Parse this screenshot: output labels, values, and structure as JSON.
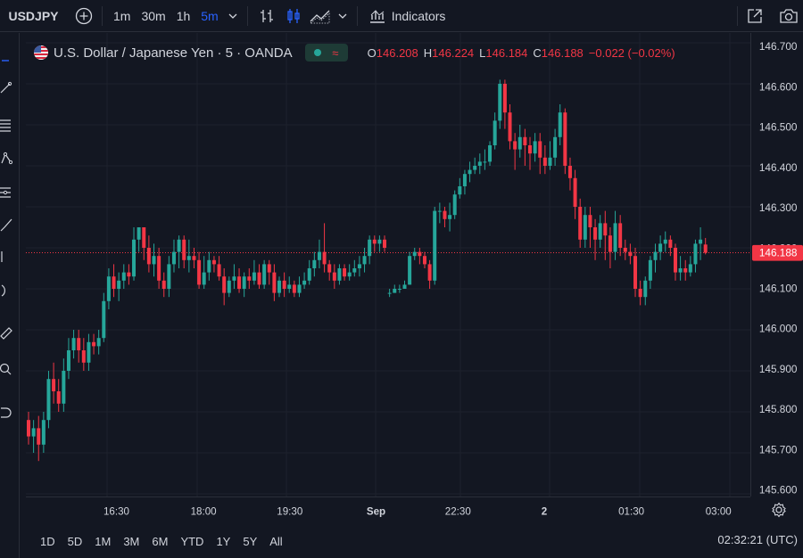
{
  "toolbar": {
    "symbol": "USDJPY",
    "timeframes": [
      "1m",
      "30m",
      "1h",
      "5m"
    ],
    "active_timeframe": "5m",
    "indicators_label": "Indicators"
  },
  "legend": {
    "title": "U.S. Dollar / Japanese Yen · 5 · OANDA",
    "open_label": "O",
    "open": "146.208",
    "high_label": "H",
    "high": "146.224",
    "low_label": "L",
    "low": "146.184",
    "close_label": "C",
    "close": "146.188",
    "change": "−0.022 (−0.02%)"
  },
  "price_axis": {
    "ticks": [
      "146.700",
      "146.600",
      "146.500",
      "146.400",
      "146.300",
      "146.200",
      "146.100",
      "146.000",
      "145.900",
      "145.800",
      "145.700",
      "145.600"
    ],
    "current": "146.188"
  },
  "time_axis": {
    "ticks": [
      "16:30",
      "18:00",
      "19:30",
      "Sep",
      "22:30",
      "2",
      "01:30",
      "03:00"
    ]
  },
  "bottom": {
    "ranges": [
      "1D",
      "5D",
      "1M",
      "3M",
      "6M",
      "YTD",
      "1Y",
      "5Y",
      "All"
    ],
    "clock": "02:32:21 (UTC)"
  },
  "colors": {
    "up": "#26a69a",
    "down": "#f23645",
    "accent": "#2962ff",
    "background": "#131722"
  },
  "chart_data": {
    "type": "candlestick",
    "title": "U.S. Dollar / Japanese Yen · 5 · OANDA",
    "ylim": [
      145.6,
      146.7
    ],
    "current_price": 146.188,
    "x_ticks": [
      "16:30",
      "18:00",
      "19:30",
      "Sep",
      "22:30",
      "2",
      "01:30",
      "03:00"
    ],
    "candles": [
      [
        145.78,
        145.74,
        145.8,
        145.72
      ],
      [
        145.74,
        145.76,
        145.78,
        145.7
      ],
      [
        145.76,
        145.72,
        145.79,
        145.68
      ],
      [
        145.72,
        145.78,
        145.8,
        145.7
      ],
      [
        145.78,
        145.88,
        145.9,
        145.76
      ],
      [
        145.88,
        145.85,
        145.92,
        145.82
      ],
      [
        145.85,
        145.82,
        145.88,
        145.8
      ],
      [
        145.82,
        145.9,
        145.93,
        145.8
      ],
      [
        145.9,
        145.95,
        145.98,
        145.88
      ],
      [
        145.95,
        145.98,
        146.0,
        145.93
      ],
      [
        145.98,
        145.95,
        146.0,
        145.92
      ],
      [
        145.95,
        145.92,
        145.98,
        145.9
      ],
      [
        145.92,
        145.97,
        145.99,
        145.9
      ],
      [
        145.97,
        145.96,
        145.99,
        145.94
      ],
      [
        145.96,
        145.98,
        146.0,
        145.94
      ],
      [
        145.98,
        146.07,
        146.09,
        145.97
      ],
      [
        146.07,
        146.13,
        146.15,
        146.05
      ],
      [
        146.13,
        146.1,
        146.16,
        146.08
      ],
      [
        146.1,
        146.12,
        146.14,
        146.07
      ],
      [
        146.12,
        146.14,
        146.16,
        146.1
      ],
      [
        146.14,
        146.13,
        146.16,
        146.11
      ],
      [
        146.13,
        146.22,
        146.25,
        146.12
      ],
      [
        146.22,
        146.25,
        146.25,
        146.19
      ],
      [
        146.25,
        146.2,
        146.25,
        146.17
      ],
      [
        146.2,
        146.16,
        146.23,
        146.14
      ],
      [
        146.16,
        146.18,
        146.21,
        146.13
      ],
      [
        146.18,
        146.12,
        146.2,
        146.1
      ],
      [
        146.12,
        146.1,
        146.14,
        146.08
      ],
      [
        146.1,
        146.16,
        146.18,
        146.08
      ],
      [
        146.16,
        146.19,
        146.22,
        146.14
      ],
      [
        146.19,
        146.22,
        146.23,
        146.15
      ],
      [
        146.22,
        146.17,
        146.23,
        146.15
      ],
      [
        146.17,
        146.18,
        146.22,
        146.14
      ],
      [
        146.18,
        146.17,
        146.2,
        146.15
      ],
      [
        146.17,
        146.11,
        146.19,
        146.1
      ],
      [
        146.11,
        146.14,
        146.18,
        146.1
      ],
      [
        146.14,
        146.17,
        146.19,
        146.12
      ],
      [
        146.17,
        146.16,
        146.18,
        146.14
      ],
      [
        146.16,
        146.13,
        146.18,
        146.12
      ],
      [
        146.13,
        146.09,
        146.15,
        146.06
      ],
      [
        146.09,
        146.12,
        146.13,
        146.08
      ],
      [
        146.12,
        146.13,
        146.16,
        146.1
      ],
      [
        146.13,
        146.1,
        146.15,
        146.09
      ],
      [
        146.1,
        146.13,
        146.14,
        146.08
      ],
      [
        146.13,
        146.12,
        146.15,
        146.1
      ],
      [
        146.12,
        146.14,
        146.17,
        146.11
      ],
      [
        146.14,
        146.11,
        146.16,
        146.1
      ],
      [
        146.11,
        146.16,
        146.17,
        146.1
      ],
      [
        146.16,
        146.14,
        146.17,
        146.11
      ],
      [
        146.14,
        146.09,
        146.16,
        146.07
      ],
      [
        146.09,
        146.12,
        146.13,
        146.08
      ],
      [
        146.12,
        146.1,
        146.14,
        146.08
      ],
      [
        146.1,
        146.11,
        146.13,
        146.09
      ],
      [
        146.11,
        146.09,
        146.12,
        146.08
      ],
      [
        146.09,
        146.11,
        146.13,
        146.08
      ],
      [
        146.11,
        146.12,
        146.14,
        146.1
      ],
      [
        146.12,
        146.15,
        146.17,
        146.11
      ],
      [
        146.15,
        146.17,
        146.19,
        146.13
      ],
      [
        146.17,
        146.19,
        146.22,
        146.15
      ],
      [
        146.19,
        146.16,
        146.26,
        146.14
      ],
      [
        146.16,
        146.14,
        146.17,
        146.12
      ],
      [
        146.14,
        146.12,
        146.16,
        146.1
      ],
      [
        146.12,
        146.15,
        146.16,
        146.11
      ],
      [
        146.15,
        146.13,
        146.16,
        146.12
      ],
      [
        146.13,
        146.14,
        146.16,
        146.12
      ],
      [
        146.14,
        146.15,
        146.17,
        146.13
      ],
      [
        146.15,
        146.16,
        146.18,
        146.13
      ],
      [
        146.16,
        146.18,
        146.2,
        146.14
      ],
      [
        146.18,
        146.22,
        146.23,
        146.16
      ],
      [
        146.22,
        146.21,
        146.23,
        146.19
      ],
      [
        146.21,
        146.22,
        146.23,
        146.19
      ],
      [
        146.22,
        146.2,
        146.23,
        146.19
      ],
      [
        146.09,
        146.09,
        146.1,
        146.08
      ],
      [
        146.09,
        146.1,
        146.11,
        146.09
      ],
      [
        146.1,
        146.1,
        146.11,
        146.09
      ],
      [
        146.1,
        146.11,
        146.12,
        146.1
      ],
      [
        146.11,
        146.18,
        146.19,
        146.11
      ],
      [
        146.18,
        146.19,
        146.2,
        146.17
      ],
      [
        146.19,
        146.18,
        146.2,
        146.16
      ],
      [
        146.18,
        146.16,
        146.19,
        146.15
      ],
      [
        146.16,
        146.12,
        146.17,
        146.1
      ],
      [
        146.12,
        146.29,
        146.3,
        146.11
      ],
      [
        146.29,
        146.29,
        146.31,
        146.26
      ],
      [
        146.29,
        146.27,
        146.3,
        146.25
      ],
      [
        146.27,
        146.28,
        146.31,
        146.24
      ],
      [
        146.28,
        146.33,
        146.34,
        146.27
      ],
      [
        146.33,
        146.35,
        146.37,
        146.32
      ],
      [
        146.35,
        146.38,
        146.39,
        146.33
      ],
      [
        146.38,
        146.39,
        146.41,
        146.36
      ],
      [
        146.39,
        146.4,
        146.42,
        146.38
      ],
      [
        146.4,
        146.41,
        146.43,
        146.38
      ],
      [
        146.41,
        146.41,
        146.44,
        146.39
      ],
      [
        146.41,
        146.45,
        146.46,
        146.4
      ],
      [
        146.45,
        146.51,
        146.53,
        146.44
      ],
      [
        146.51,
        146.6,
        146.61,
        146.49
      ],
      [
        146.6,
        146.53,
        146.61,
        146.49
      ],
      [
        146.53,
        146.46,
        146.55,
        146.44
      ],
      [
        146.46,
        146.44,
        146.48,
        146.39
      ],
      [
        146.44,
        146.47,
        146.5,
        146.42
      ],
      [
        146.47,
        146.45,
        146.49,
        146.4
      ],
      [
        146.45,
        146.43,
        146.47,
        146.39
      ],
      [
        146.43,
        146.46,
        146.48,
        146.41
      ],
      [
        146.46,
        146.42,
        146.48,
        146.38
      ],
      [
        146.42,
        146.4,
        146.45,
        146.38
      ],
      [
        146.4,
        146.42,
        146.46,
        146.39
      ],
      [
        146.42,
        146.47,
        146.49,
        146.4
      ],
      [
        146.47,
        146.53,
        146.55,
        146.45
      ],
      [
        146.53,
        146.4,
        146.54,
        146.38
      ],
      [
        146.4,
        146.37,
        146.42,
        146.34
      ],
      [
        146.37,
        146.3,
        146.39,
        146.27
      ],
      [
        146.3,
        146.22,
        146.32,
        146.2
      ],
      [
        146.22,
        146.28,
        146.3,
        146.2
      ],
      [
        146.28,
        146.25,
        146.3,
        146.2
      ],
      [
        146.25,
        146.22,
        146.27,
        146.17
      ],
      [
        146.22,
        146.26,
        146.28,
        146.2
      ],
      [
        146.26,
        146.23,
        146.29,
        146.17
      ],
      [
        146.23,
        146.19,
        146.25,
        146.15
      ],
      [
        146.19,
        146.26,
        146.29,
        146.17
      ],
      [
        146.26,
        146.2,
        146.28,
        146.18
      ],
      [
        146.2,
        146.19,
        146.22,
        146.17
      ],
      [
        146.19,
        146.18,
        146.21,
        146.16
      ],
      [
        146.18,
        146.1,
        146.2,
        146.08
      ],
      [
        146.1,
        146.08,
        146.12,
        146.06
      ],
      [
        146.08,
        146.12,
        146.13,
        146.06
      ],
      [
        146.12,
        146.17,
        146.18,
        146.1
      ],
      [
        146.17,
        146.19,
        146.21,
        146.14
      ],
      [
        146.19,
        146.21,
        146.23,
        146.17
      ],
      [
        146.21,
        146.22,
        146.24,
        146.19
      ],
      [
        146.22,
        146.2,
        146.23,
        146.18
      ],
      [
        146.2,
        146.14,
        146.21,
        146.12
      ],
      [
        146.14,
        146.15,
        146.18,
        146.12
      ],
      [
        146.15,
        146.14,
        146.17,
        146.12
      ],
      [
        146.14,
        146.16,
        146.18,
        146.13
      ],
      [
        146.16,
        146.21,
        146.22,
        146.14
      ],
      [
        146.21,
        146.22,
        146.25,
        146.17
      ],
      [
        146.208,
        146.188,
        146.224,
        146.184
      ]
    ]
  }
}
